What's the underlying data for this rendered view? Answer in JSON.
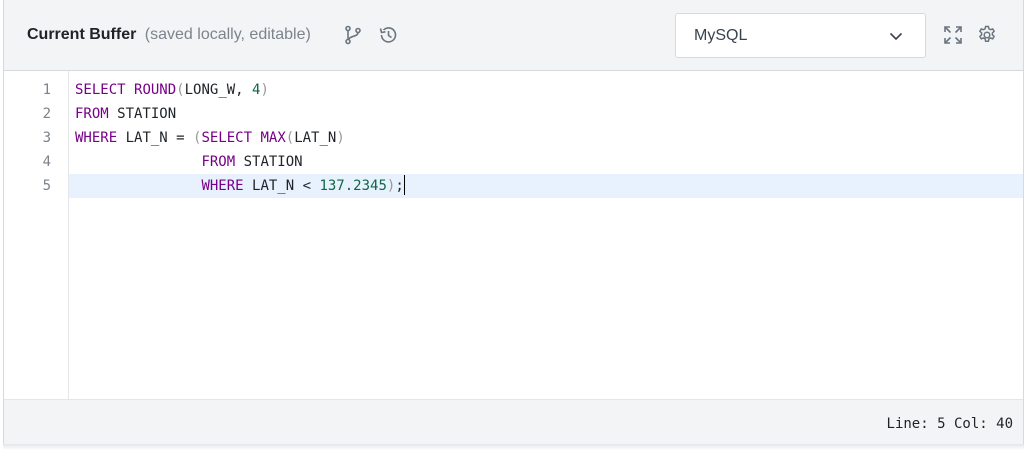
{
  "header": {
    "title": "Current Buffer",
    "subtitle": "(saved locally, editable)",
    "icons": [
      "branch-icon",
      "history-icon",
      "expand-icon",
      "settings-icon"
    ],
    "language_select": {
      "value": "MySQL"
    }
  },
  "editor": {
    "line_numbers": [
      "1",
      "2",
      "3",
      "4",
      "5"
    ],
    "active_line": 5,
    "lines": [
      [
        {
          "t": "SELECT",
          "c": "kw"
        },
        {
          "t": " ",
          "c": "plain"
        },
        {
          "t": "ROUND",
          "c": "kw"
        },
        {
          "t": "(",
          "c": "paren"
        },
        {
          "t": "LONG_W, ",
          "c": "plain"
        },
        {
          "t": "4",
          "c": "num"
        },
        {
          "t": ")",
          "c": "paren"
        }
      ],
      [
        {
          "t": "FROM",
          "c": "kw"
        },
        {
          "t": " STATION",
          "c": "plain"
        }
      ],
      [
        {
          "t": "WHERE",
          "c": "kw"
        },
        {
          "t": " LAT_N = ",
          "c": "plain"
        },
        {
          "t": "(",
          "c": "paren"
        },
        {
          "t": "SELECT",
          "c": "kw"
        },
        {
          "t": " ",
          "c": "plain"
        },
        {
          "t": "MAX",
          "c": "kw"
        },
        {
          "t": "(",
          "c": "paren"
        },
        {
          "t": "LAT_N",
          "c": "plain"
        },
        {
          "t": ")",
          "c": "paren"
        }
      ],
      [
        {
          "t": "               ",
          "c": "plain"
        },
        {
          "t": "FROM",
          "c": "kw"
        },
        {
          "t": " STATION",
          "c": "plain"
        }
      ],
      [
        {
          "t": "               ",
          "c": "plain"
        },
        {
          "t": "WHERE",
          "c": "kw"
        },
        {
          "t": " LAT_N < ",
          "c": "plain"
        },
        {
          "t": "137.2345",
          "c": "num"
        },
        {
          "t": ")",
          "c": "paren"
        },
        {
          "t": ";",
          "c": "plain"
        }
      ]
    ]
  },
  "footer": {
    "line_label": "Line:",
    "line_value": "5",
    "col_label": "Col:",
    "col_value": "40"
  },
  "colors": {
    "keyword": "#770088",
    "number": "#116644",
    "active_line_bg": "#e8f2fe",
    "header_bg": "#f3f4f6"
  }
}
